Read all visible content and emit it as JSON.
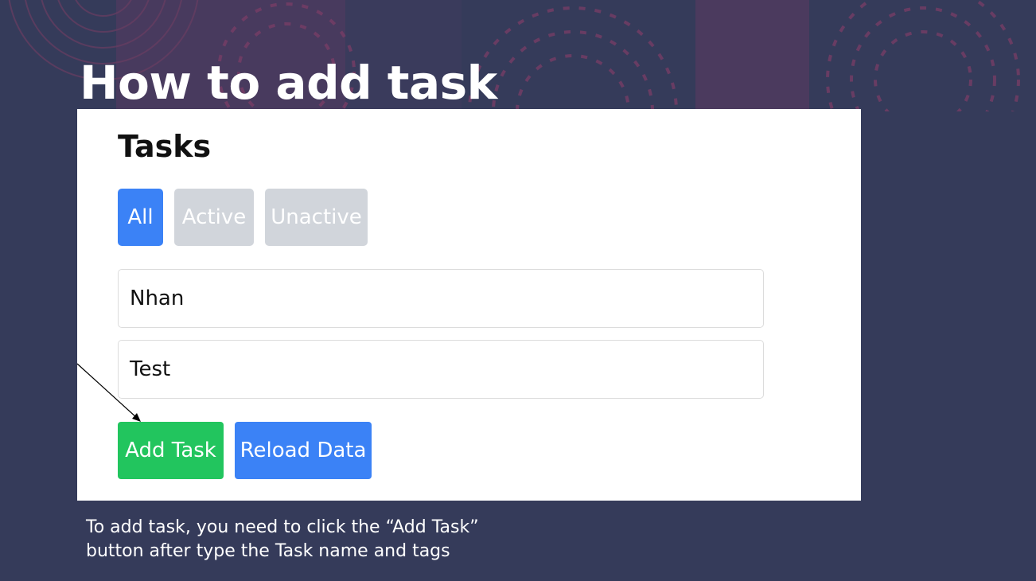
{
  "slide": {
    "title": "How to add task",
    "caption_line1": "To add task, you need to click the “Add Task”",
    "caption_line2": "button after type the Task name and tags"
  },
  "app": {
    "heading": "Tasks",
    "filters": [
      {
        "label": "All",
        "selected": true
      },
      {
        "label": "Active",
        "selected": false
      },
      {
        "label": "Unactive",
        "selected": false
      }
    ],
    "task_name_value": "Nhan",
    "task_tags_value": "Test",
    "add_button_label": "Add Task",
    "reload_button_label": "Reload Data"
  },
  "colors": {
    "background": "#353b5a",
    "decor": "#5a3b5f",
    "primary_blue": "#3b82f6",
    "success_green": "#22c55e",
    "inactive_gray": "#d1d5db"
  }
}
